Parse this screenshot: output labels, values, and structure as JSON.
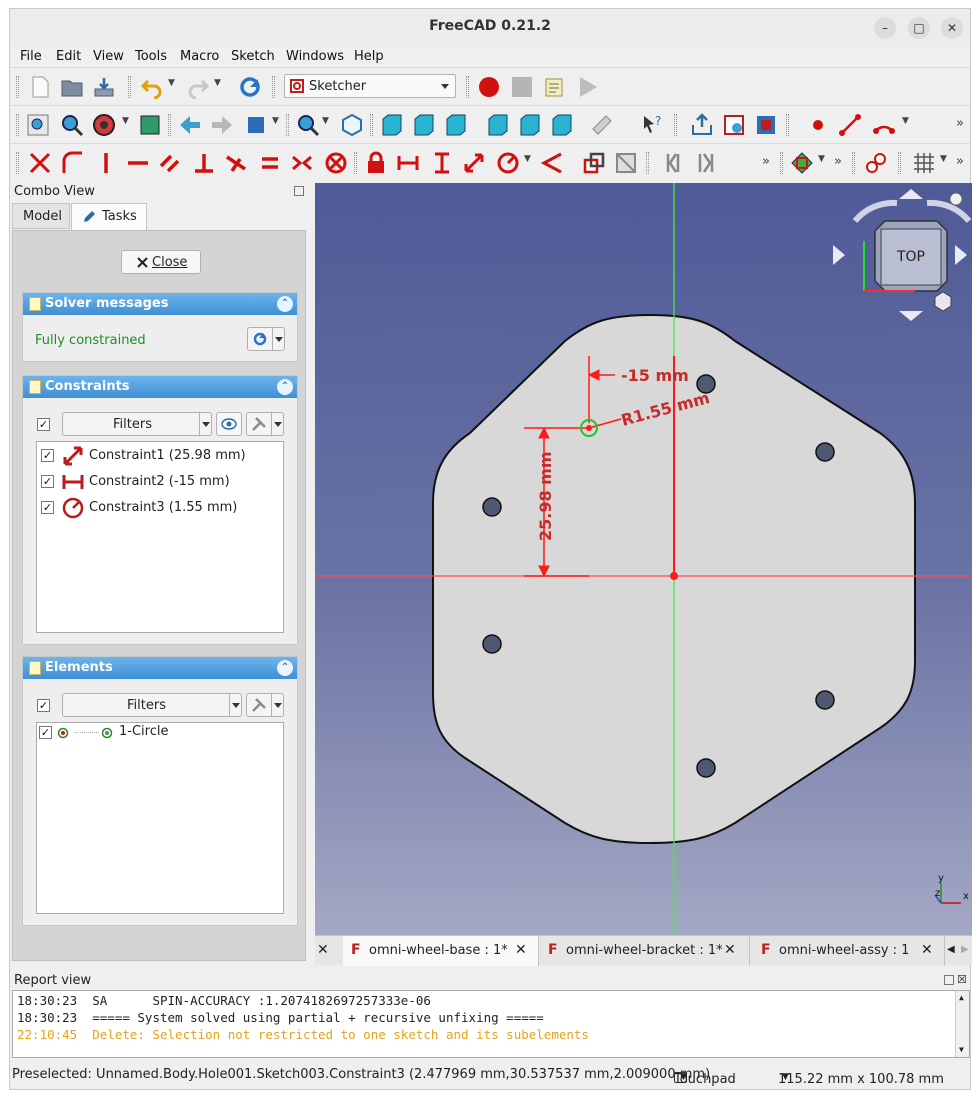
{
  "window": {
    "title": "FreeCAD 0.21.2"
  },
  "menu": [
    "File",
    "Edit",
    "View",
    "Tools",
    "Macro",
    "Sketch",
    "Windows",
    "Help"
  ],
  "toolbar": {
    "workbench": "Sketcher",
    "more": "»"
  },
  "combo": {
    "title": "Combo View",
    "tabs": [
      "Model",
      "Tasks"
    ],
    "close_label": "Close",
    "solver": {
      "title": "Solver messages",
      "status": "Fully constrained"
    },
    "constraints": {
      "title": "Constraints",
      "filter_label": "Filters",
      "items": [
        "Constraint1 (25.98 mm)",
        "Constraint2 (-15 mm)",
        "Constraint3 (1.55 mm)"
      ]
    },
    "elements": {
      "title": "Elements",
      "filter_label": "Filters",
      "items": [
        "1-Circle"
      ]
    }
  },
  "viewport": {
    "navcube_label": "TOP",
    "dims": {
      "horizontal": "-15 mm",
      "radius": "R1.55 mm",
      "vertical": "25.98 mm"
    },
    "axes": {
      "x": "x",
      "y": "y",
      "z": "z"
    },
    "colors": {
      "constraint": "#ff1a1a",
      "x_axis": "#ff4d4d",
      "y_axis": "#3ef03e",
      "selected": "#22c422",
      "sketch_fill": "#d9d9d9"
    }
  },
  "doc_tabs": [
    "omni-wheel-base : 1*",
    "omni-wheel-bracket : 1*",
    "omni-wheel-assy : 1"
  ],
  "report": {
    "title": "Report view",
    "lines": [
      "18:30:23  SA      SPIN-ACCURACY :1.2074182697257333e-06",
      "18:30:23  ===== System solved using partial + recursive unfixing =====",
      "22:10:45  Delete: Selection not restricted to one sketch and its subelements"
    ],
    "warning_color": "#e6a21a"
  },
  "status": {
    "preselected": "Preselected: Unnamed.Body.Hole001.Sketch003.Constraint3 (2.477969 mm,30.537537 mm,2.009000 mm)",
    "navigation": "Touchpad",
    "dimensions": "115.22 mm x 100.78 mm"
  }
}
